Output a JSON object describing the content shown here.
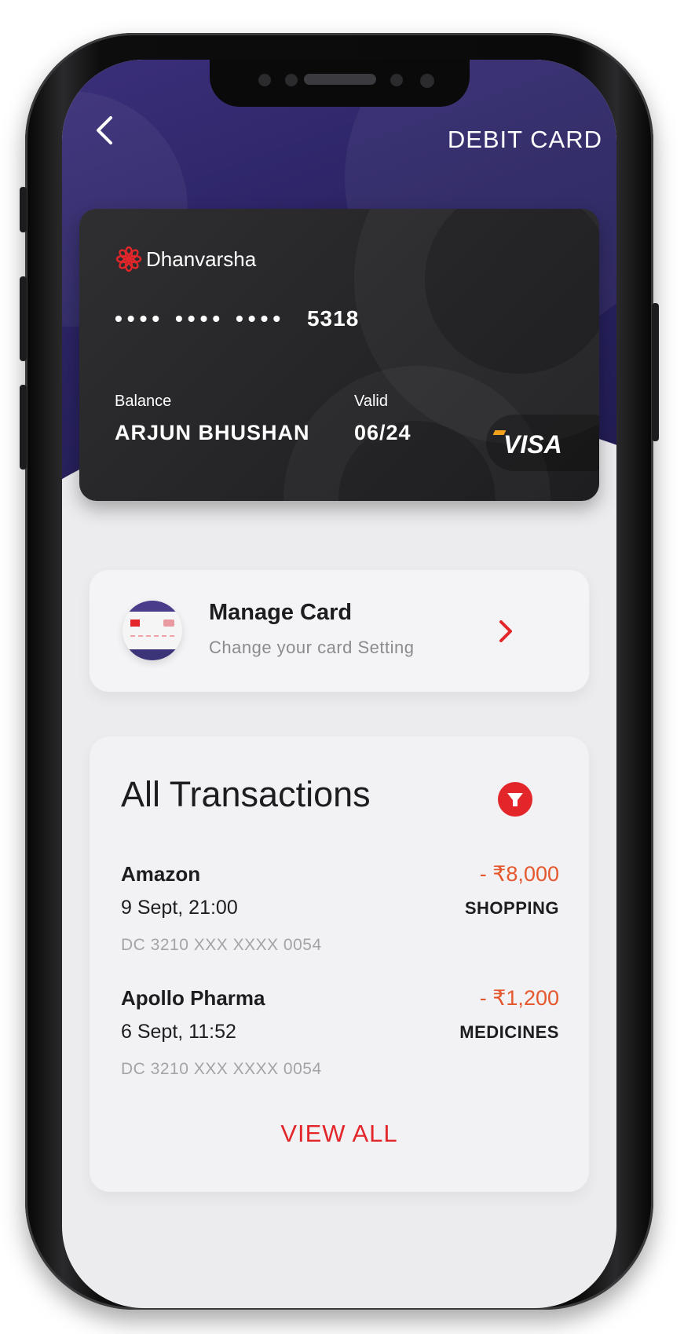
{
  "header": {
    "title": "DEBIT CARD",
    "back_icon": "chevron-left-icon"
  },
  "card": {
    "brand": "Dhanvarsha",
    "masked_number": "•••• •••• ••••",
    "last_four": "5318",
    "balance_label": "Balance",
    "holder_name": "ARJUN BHUSHAN",
    "valid_label": "Valid",
    "valid_thru": "06/24",
    "network": "VISA",
    "brand_color": "#e2262a"
  },
  "manage_card": {
    "title": "Manage Card",
    "subtitle": "Change your card Setting",
    "icon": "credit-card-icon"
  },
  "transactions": {
    "title": "All Transactions",
    "filter_icon": "filter-icon",
    "items": [
      {
        "merchant": "Amazon",
        "amount": "- ₹8,000",
        "date": "9 Sept, 21:00",
        "category": "SHOPPING",
        "card": "DC 3210 XXX XXXX 0054"
      },
      {
        "merchant": "Apollo Pharma",
        "amount": "- ₹1,200",
        "date": "6 Sept, 11:52",
        "category": "MEDICINES",
        "card": "DC 3210 XXX XXXX 0054"
      }
    ],
    "view_all": "VIEW ALL"
  },
  "colors": {
    "header_bg": "#2a2363",
    "accent_red": "#e2262a",
    "amount_orange": "#e5572c",
    "card_bg": "#2a2a2c"
  }
}
